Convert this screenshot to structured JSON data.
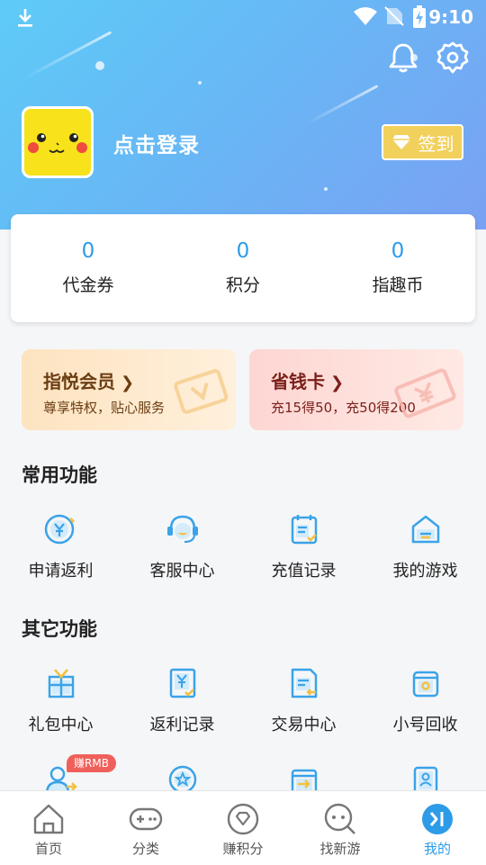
{
  "status_bar": {
    "time": "9:10"
  },
  "profile": {
    "login_text": "点击登录",
    "signin_label": "签到"
  },
  "stats": [
    {
      "value": "0",
      "label": "代金券"
    },
    {
      "value": "0",
      "label": "积分"
    },
    {
      "value": "0",
      "label": "指趣币"
    }
  ],
  "promos": {
    "vip": {
      "title": "指悦会员",
      "subtitle": "尊享特权，贴心服务"
    },
    "save": {
      "title": "省钱卡",
      "subtitle": "充15得50，充50得200"
    }
  },
  "common": {
    "title": "常用功能",
    "items": [
      {
        "label": "申请返利",
        "icon": "rebate-apply-icon"
      },
      {
        "label": "客服中心",
        "icon": "customer-service-icon"
      },
      {
        "label": "充值记录",
        "icon": "recharge-record-icon"
      },
      {
        "label": "我的游戏",
        "icon": "my-games-icon"
      }
    ]
  },
  "other": {
    "title": "其它功能",
    "items": [
      {
        "label": "礼包中心",
        "icon": "gift-icon"
      },
      {
        "label": "返利记录",
        "icon": "rebate-record-icon"
      },
      {
        "label": "交易中心",
        "icon": "trade-icon"
      },
      {
        "label": "小号回收",
        "icon": "account-recycle-icon"
      }
    ],
    "badge": "赚RMB"
  },
  "nav": [
    {
      "label": "首页",
      "icon": "home-icon"
    },
    {
      "label": "分类",
      "icon": "gamepad-icon"
    },
    {
      "label": "赚积分",
      "icon": "points-icon"
    },
    {
      "label": "找新游",
      "icon": "find-game-icon"
    },
    {
      "label": "我的",
      "icon": "me-icon",
      "active": true
    }
  ],
  "colors": {
    "accent": "#2d9be8",
    "icon_blue": "#3aa3e8",
    "gold": "#f2d05c"
  }
}
